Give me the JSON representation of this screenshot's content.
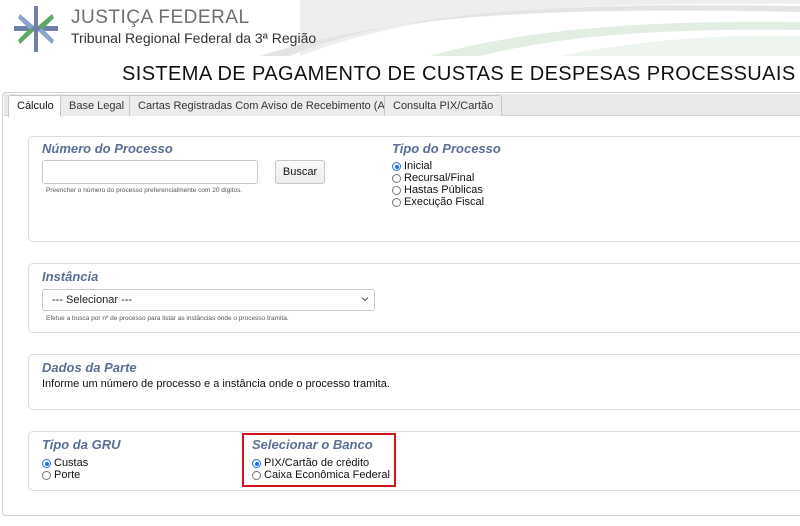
{
  "header": {
    "org_title": "JUSTIÇA FEDERAL",
    "org_subtitle": "Tribunal Regional Federal da 3ª Região"
  },
  "system_title": "SISTEMA DE PAGAMENTO DE CUSTAS E DESPESAS PROCESSUAIS",
  "tabs": [
    {
      "label": "Cálculo",
      "active": true
    },
    {
      "label": "Base Legal",
      "active": false
    },
    {
      "label": "Cartas Registradas Com Aviso de Recebimento (AR)",
      "active": false
    },
    {
      "label": "Consulta PIX/Cartão",
      "active": false
    }
  ],
  "numero_processo": {
    "legend": "Número do Processo",
    "value": "",
    "search_button": "Buscar",
    "hint": "Preencher o número do processo preferencialmente com 20 dígitos."
  },
  "tipo_processo": {
    "legend": "Tipo do Processo",
    "options": [
      {
        "label": "Inicial",
        "selected": true
      },
      {
        "label": "Recursal/Final",
        "selected": false
      },
      {
        "label": "Hastas Públicas",
        "selected": false
      },
      {
        "label": "Execução Fiscal",
        "selected": false
      }
    ]
  },
  "instancia": {
    "legend": "Instância",
    "selected": "--- Selecionar ---",
    "hint": "Efetue a busca por nº de processo para listar as instâncias onde o processo tramita."
  },
  "dados_parte": {
    "legend": "Dados da Parte",
    "message": "Informe um número de processo e a instância onde o processo tramita."
  },
  "tipo_gru": {
    "legend": "Tipo da GRU",
    "options": [
      {
        "label": "Custas",
        "selected": true
      },
      {
        "label": "Porte",
        "selected": false
      }
    ]
  },
  "banco": {
    "legend": "Selecionar o Banco",
    "options": [
      {
        "label": "PIX/Cartão de crédito",
        "selected": true
      },
      {
        "label": "Caixa Econômica Federal",
        "selected": false
      }
    ]
  },
  "colors": {
    "legend": "#5a6e97",
    "highlight": "#d4141c",
    "radio_selected": "#1a73e8"
  }
}
